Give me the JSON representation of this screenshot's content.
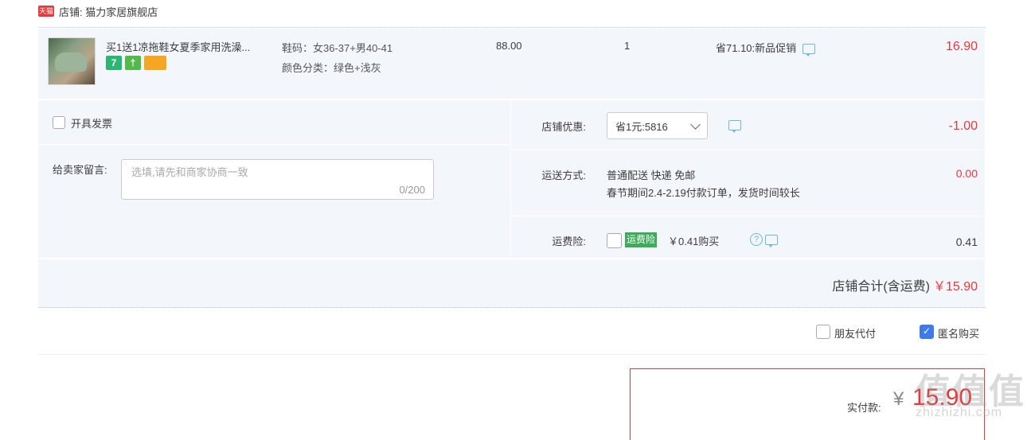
{
  "shop": {
    "badge": "天猫",
    "name_label": "店铺: 猫力家居旗舰店"
  },
  "item": {
    "title": "买1送1凉拖鞋女夏季家用洗澡...",
    "badges": [
      "7",
      "†",
      ""
    ],
    "sku_size": "鞋码：女36-37+男40-41",
    "sku_color": "颜色分类：绿色+浅灰",
    "price": "88.00",
    "quantity": "1",
    "promo": "省71.10:新品促销",
    "subtotal": "16.90"
  },
  "invoice": {
    "label": "开具发票",
    "checked": false
  },
  "message": {
    "label": "给卖家留言:",
    "placeholder": "选填,请先和商家协商一致",
    "count": "0/200"
  },
  "coupon": {
    "label": "店铺优惠:",
    "selected": "省1元:5816",
    "value": "-1.00"
  },
  "shipping": {
    "label": "运送方式:",
    "line1": "普通配送 快递 免邮",
    "line2": "春节期间2.4-2.19付款订单，发货时间较长",
    "value": "0.00"
  },
  "insurance": {
    "label": "运费险:",
    "badge": "运费险",
    "price": "￥0.41购买",
    "help": "?",
    "value": "0.41",
    "checked": false
  },
  "total": {
    "label": "店铺合计(含运费)",
    "value": "￥15.90"
  },
  "options": {
    "friend_pay": "朋友代付",
    "friend_checked": false,
    "anonymous": "匿名购买",
    "anon_checked": true,
    "check_mark": "✓"
  },
  "payment": {
    "label": "实付款:",
    "yen": "¥",
    "value": "15.90"
  },
  "watermark": {
    "main": "值值值",
    "sub": "zhizhizhi.com"
  },
  "colors": {
    "accent_red": "#e4393c",
    "panel_bg": "#f3f7fc",
    "checkbox_blue": "#3f7be8",
    "insurance_green": "#3dab5a"
  }
}
